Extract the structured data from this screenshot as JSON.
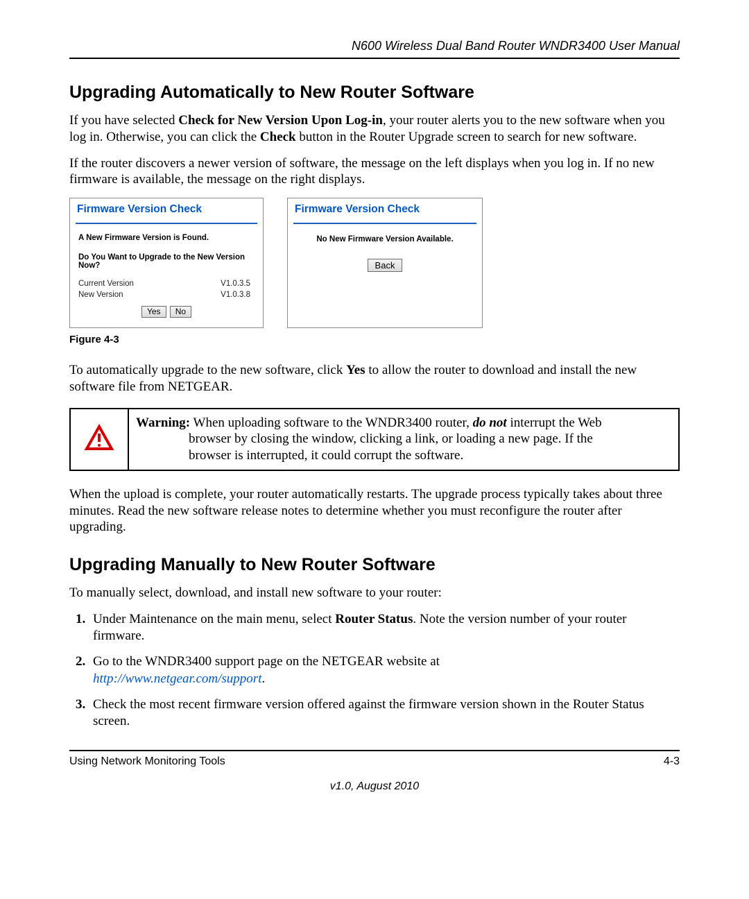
{
  "header": {
    "doc_title": "N600 Wireless Dual Band Router WNDR3400 User Manual"
  },
  "section_auto": {
    "heading": "Upgrading Automatically to New Router Software",
    "para1_pre": "If you have selected ",
    "para1_bold1": "Check for New Version Upon Log-in",
    "para1_mid": ", your router alerts you to the new software when you log in. Otherwise, you can click the ",
    "para1_bold2": "Check",
    "para1_post": " button in the Router Upgrade screen to search for new software.",
    "para2": "If the router discovers a newer version of software, the message on the left displays when you log in. If no new firmware is available, the message on the right displays."
  },
  "dialog_left": {
    "title": "Firmware Version Check",
    "msg_found": "A New Firmware Version is Found.",
    "prompt": "Do You Want to Upgrade to the New Version Now?",
    "current_label": "Current Version",
    "current_value": "V1.0.3.5",
    "new_label": "New Version",
    "new_value": "V1.0.3.8",
    "yes_label": "Yes",
    "no_label": "No"
  },
  "dialog_right": {
    "title": "Firmware Version Check",
    "msg_none": "No New Firmware Version Available.",
    "back_label": "Back"
  },
  "figure_caption": "Figure 4-3",
  "post_figure": {
    "text_pre": "To automatically upgrade to the new software, click ",
    "text_bold": "Yes",
    "text_post": " to allow the router to download and install the new software file from NETGEAR."
  },
  "warning": {
    "label": "Warning:",
    "line1": " When uploading software to the WNDR3400 router, ",
    "donot": "do not",
    "line1_post": " interrupt the Web",
    "line2": "browser by closing the window, clicking a link, or loading a new page. If the",
    "line3": "browser is interrupted, it could corrupt the software."
  },
  "after_warning": "When the upload is complete, your router automatically restarts. The upgrade process typically takes about three minutes. Read the new software release notes to determine whether you must reconfigure the router after upgrading.",
  "section_manual": {
    "heading": "Upgrading Manually to New Router Software",
    "intro": "To manually select, download, and install new software to your router:",
    "step1_pre": "Under Maintenance on the main menu, select ",
    "step1_bold": "Router Status",
    "step1_post": ". Note the version number of your router firmware.",
    "step2_pre": "Go to the WNDR3400 support page on the NETGEAR website at ",
    "step2_link": "http://www.netgear.com/support",
    "step2_post": ".",
    "step3": "Check the most recent firmware version offered against the firmware version shown in the Router Status screen."
  },
  "footer": {
    "chapter": "Using Network Monitoring Tools",
    "page": "4-3",
    "version": "v1.0, August 2010"
  }
}
